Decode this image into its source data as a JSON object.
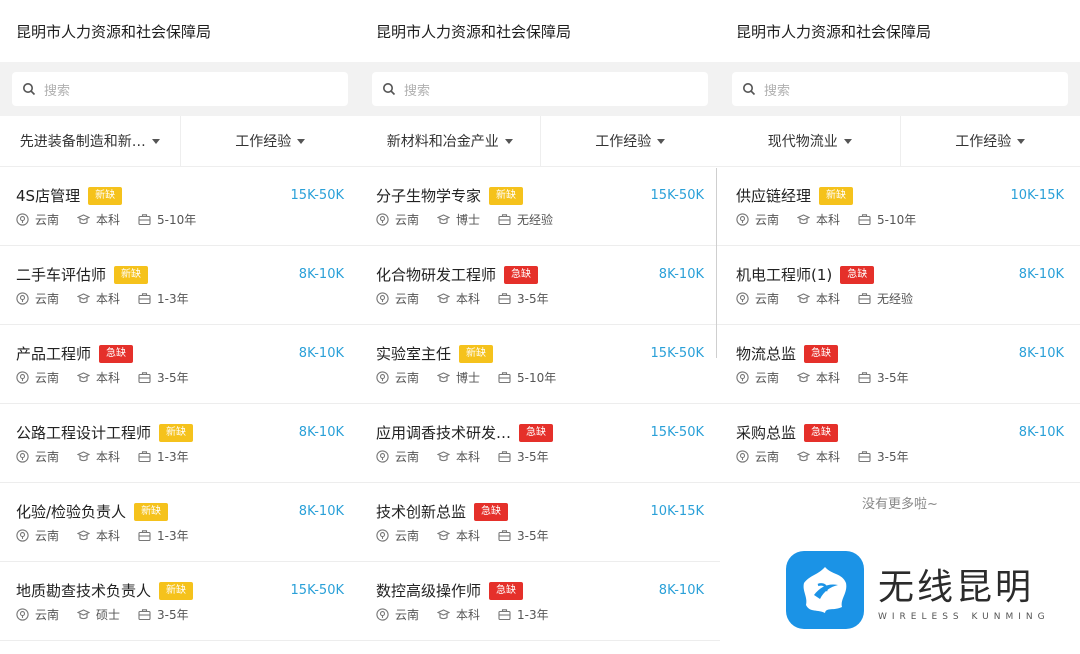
{
  "panels": [
    {
      "title": "昆明市人力资源和社会保障局",
      "search_placeholder": "搜索",
      "filters": [
        "先进装备制造和新…",
        "工作经验"
      ],
      "jobs": [
        {
          "title": "4S店管理",
          "badge": "新缺",
          "badge_color": "yellow",
          "salary": "15K-50K",
          "location": "云南",
          "education": "本科",
          "experience": "5-10年"
        },
        {
          "title": "二手车评估师",
          "badge": "新缺",
          "badge_color": "yellow",
          "salary": "8K-10K",
          "location": "云南",
          "education": "本科",
          "experience": "1-3年"
        },
        {
          "title": "产品工程师",
          "badge": "急缺",
          "badge_color": "red",
          "salary": "8K-10K",
          "location": "云南",
          "education": "本科",
          "experience": "3-5年"
        },
        {
          "title": "公路工程设计工程师",
          "badge": "新缺",
          "badge_color": "yellow",
          "salary": "8K-10K",
          "location": "云南",
          "education": "本科",
          "experience": "1-3年"
        },
        {
          "title": "化验/检验负责人",
          "badge": "新缺",
          "badge_color": "yellow",
          "salary": "8K-10K",
          "location": "云南",
          "education": "本科",
          "experience": "1-3年"
        },
        {
          "title": "地质勘查技术负责人",
          "badge": "新缺",
          "badge_color": "yellow",
          "salary": "15K-50K",
          "location": "云南",
          "education": "硕士",
          "experience": "3-5年"
        }
      ],
      "footer": ""
    },
    {
      "title": "昆明市人力资源和社会保障局",
      "search_placeholder": "搜索",
      "filters": [
        "新材料和冶金产业",
        "工作经验"
      ],
      "jobs": [
        {
          "title": "分子生物学专家",
          "badge": "新缺",
          "badge_color": "yellow",
          "salary": "15K-50K",
          "location": "云南",
          "education": "博士",
          "experience": "无经验"
        },
        {
          "title": "化合物研发工程师",
          "badge": "急缺",
          "badge_color": "red",
          "salary": "8K-10K",
          "location": "云南",
          "education": "本科",
          "experience": "3-5年"
        },
        {
          "title": "实验室主任",
          "badge": "新缺",
          "badge_color": "yellow",
          "salary": "15K-50K",
          "location": "云南",
          "education": "博士",
          "experience": "5-10年"
        },
        {
          "title": "应用调香技术研发…",
          "badge": "急缺",
          "badge_color": "red",
          "salary": "15K-50K",
          "location": "云南",
          "education": "本科",
          "experience": "3-5年"
        },
        {
          "title": "技术创新总监",
          "badge": "急缺",
          "badge_color": "red",
          "salary": "10K-15K",
          "location": "云南",
          "education": "本科",
          "experience": "3-5年"
        },
        {
          "title": "数控高级操作师",
          "badge": "急缺",
          "badge_color": "red",
          "salary": "8K-10K",
          "location": "云南",
          "education": "本科",
          "experience": "1-3年"
        }
      ],
      "footer": ""
    },
    {
      "title": "昆明市人力资源和社会保障局",
      "search_placeholder": "搜索",
      "filters": [
        "现代物流业",
        "工作经验"
      ],
      "jobs": [
        {
          "title": "供应链经理",
          "badge": "新缺",
          "badge_color": "yellow",
          "salary": "10K-15K",
          "location": "云南",
          "education": "本科",
          "experience": "5-10年"
        },
        {
          "title": "机电工程师(1)",
          "badge": "急缺",
          "badge_color": "red",
          "salary": "8K-10K",
          "location": "云南",
          "education": "本科",
          "experience": "无经验"
        },
        {
          "title": "物流总监",
          "badge": "急缺",
          "badge_color": "red",
          "salary": "8K-10K",
          "location": "云南",
          "education": "本科",
          "experience": "3-5年"
        },
        {
          "title": "采购总监",
          "badge": "急缺",
          "badge_color": "red",
          "salary": "8K-10K",
          "location": "云南",
          "education": "本科",
          "experience": "3-5年"
        }
      ],
      "footer": "没有更多啦~"
    }
  ],
  "watermark": {
    "cn": "无线昆明",
    "en": "WIRELESS KUNMING"
  },
  "colors": {
    "salary": "#2aa0d8",
    "badge_yellow": "#f5c21c",
    "badge_red": "#e5302a",
    "logo": "#1b93e6"
  },
  "icons": {
    "search": "search-icon",
    "location": "location-pin-icon",
    "education": "graduation-cap-icon",
    "experience": "briefcase-icon"
  }
}
